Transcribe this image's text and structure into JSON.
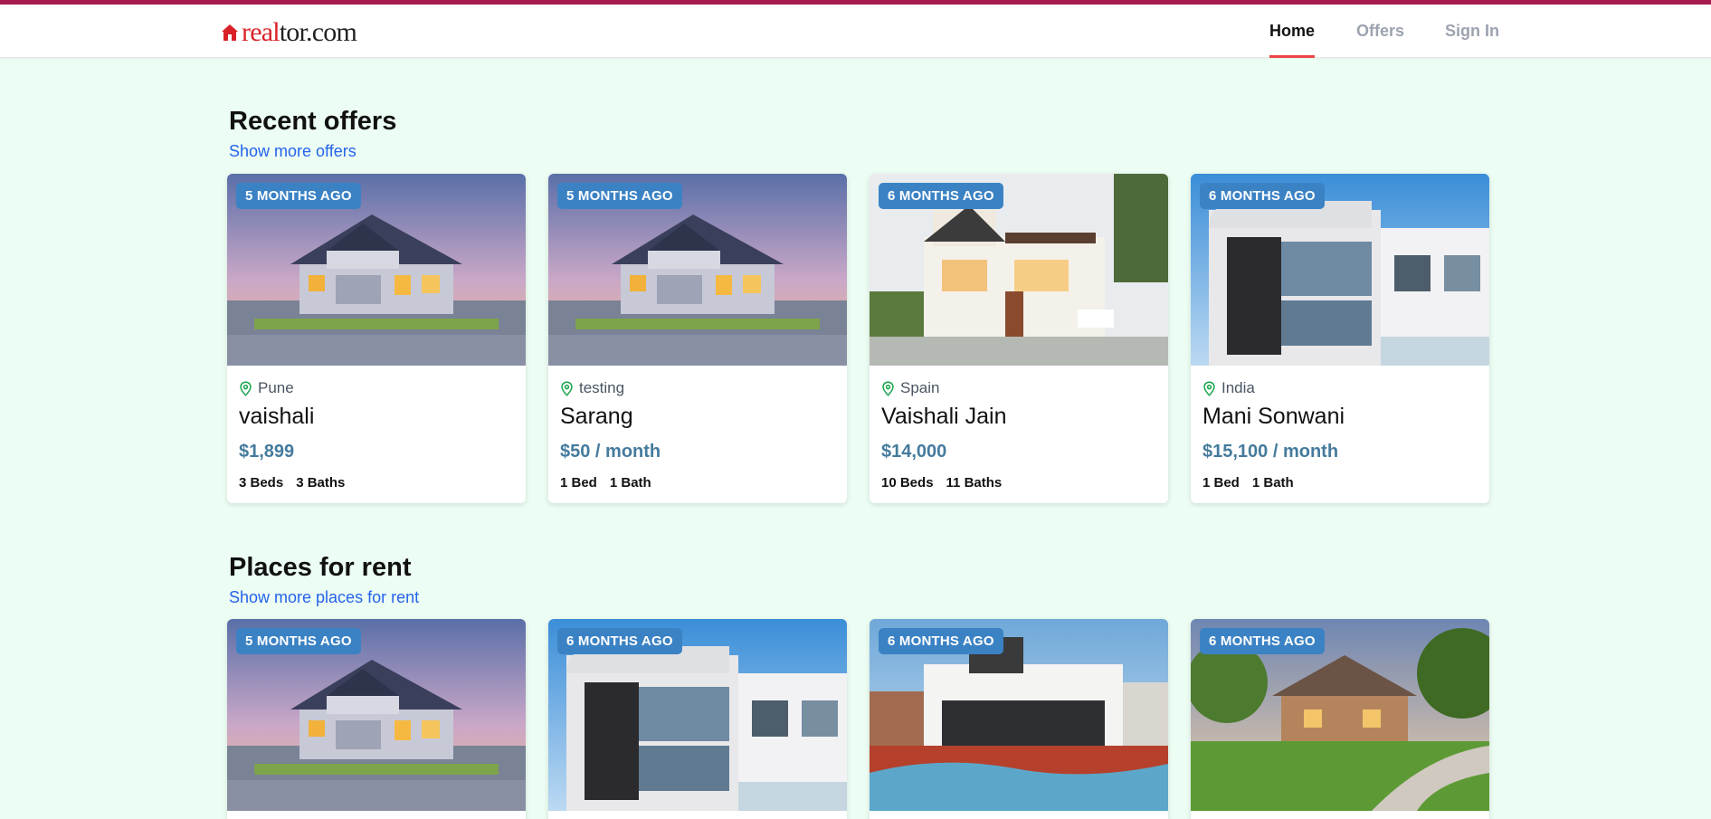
{
  "brand": {
    "logo_part1": "real",
    "logo_part2": "tor.com"
  },
  "nav": {
    "home": "Home",
    "offers": "Offers",
    "signin": "Sign In"
  },
  "sections": [
    {
      "title": "Recent offers",
      "link": "Show more offers",
      "cards": [
        {
          "badge": "5 months ago",
          "location": "Pune",
          "name": "vaishali",
          "price": "$1,899",
          "beds": "3 Beds",
          "baths": "3 Baths",
          "image": "suburban-house-dusk-image"
        },
        {
          "badge": "5 months ago",
          "location": "testing",
          "name": "Sarang",
          "price": "$50 / month",
          "beds": "1 Bed",
          "baths": "1 Bath",
          "image": "suburban-house-dusk-image"
        },
        {
          "badge": "6 months ago",
          "location": "Spain",
          "name": "Vaishali Jain",
          "price": "$14,000",
          "beds": "10 Beds",
          "baths": "11 Baths",
          "image": "modern-villa-night-image"
        },
        {
          "badge": "6 months ago",
          "location": "India",
          "name": "Mani Sonwani",
          "price": "$15,100 / month",
          "beds": "1 Bed",
          "baths": "1 Bath",
          "image": "modern-white-house-image"
        }
      ]
    },
    {
      "title": "Places for rent",
      "link": "Show more places for rent",
      "cards": [
        {
          "badge": "5 months ago",
          "image": "suburban-house-dusk-image"
        },
        {
          "badge": "6 months ago",
          "image": "modern-white-house-image"
        },
        {
          "badge": "6 months ago",
          "image": "pool-house-image"
        },
        {
          "badge": "6 months ago",
          "image": "stone-house-lawn-image"
        }
      ]
    }
  ],
  "colors": {
    "accent": "#a51b50",
    "badge": "#3b82c4",
    "price": "#457b9d",
    "link": "#2563eb",
    "background": "#ecfdf3"
  },
  "icons": {
    "location": "map-pin-icon",
    "logo": "house-icon"
  }
}
